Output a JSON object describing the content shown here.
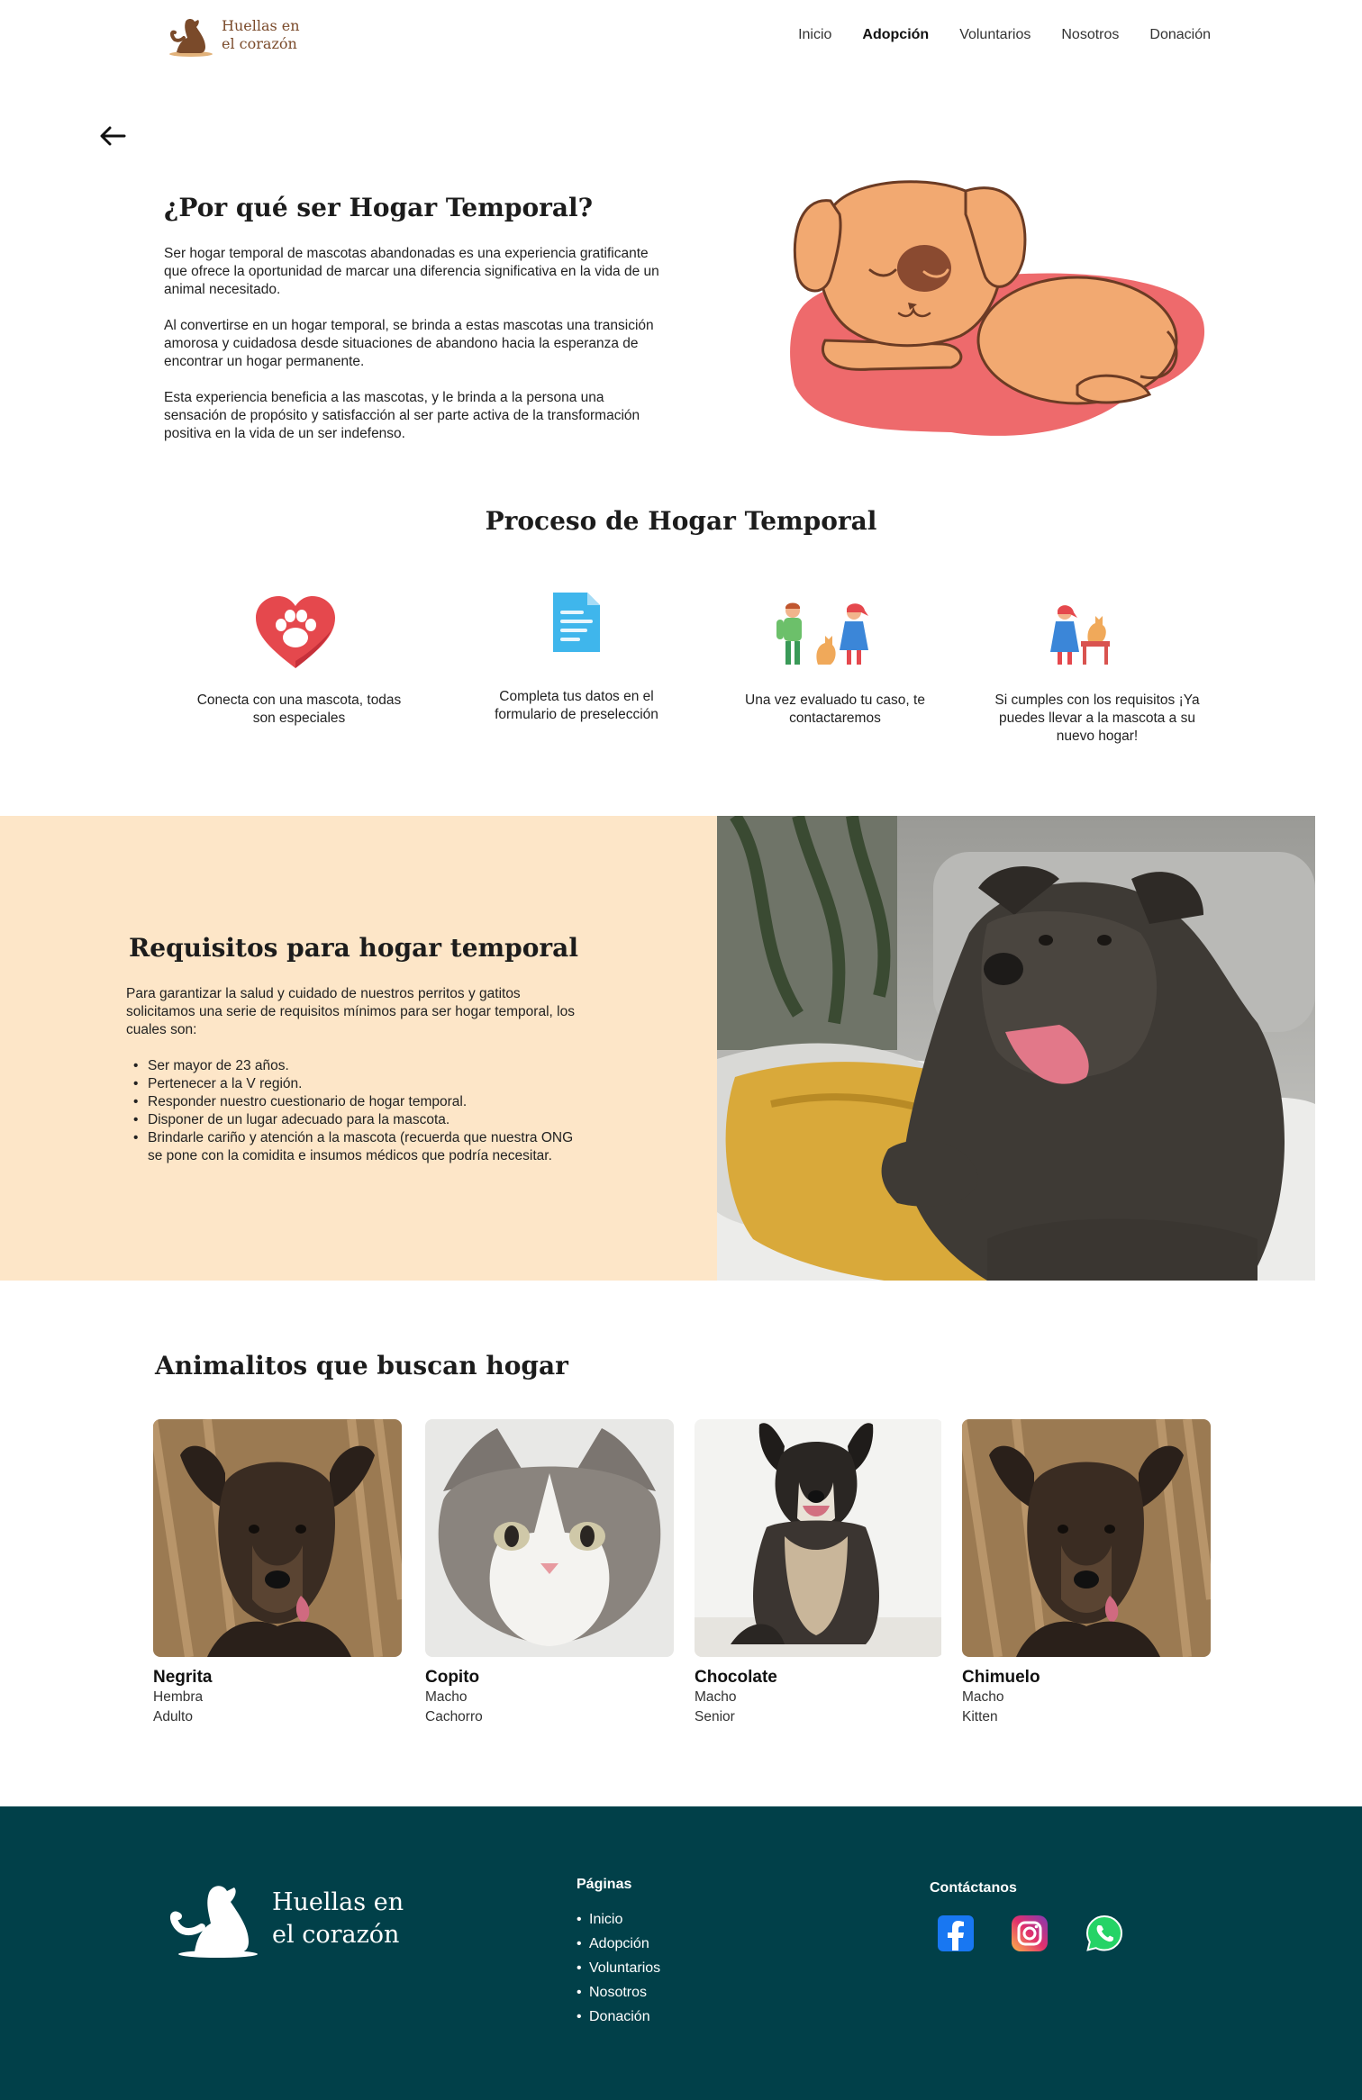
{
  "nav": {
    "brand": "Huellas en el corazón",
    "links": [
      "Inicio",
      "Adopción",
      "Voluntarios",
      "Nosotros",
      "Donación"
    ],
    "active": "Adopción"
  },
  "why": {
    "title": "¿Por qué ser Hogar Temporal?",
    "paragraphs": [
      "Ser hogar temporal de mascotas abandonadas es una experiencia gratificante que ofrece la oportunidad de marcar una diferencia significativa en la vida de un animal necesitado.",
      "Al convertirse en un hogar temporal, se brinda a estas mascotas una transición amorosa y cuidadosa desde situaciones de abandono hacia la esperanza de encontrar un hogar permanente.",
      "Esta experiencia beneficia a las mascotas, y le brinda a la persona una sensación de propósito y satisfacción al ser parte activa de la transformación positiva en la vida de un ser indefenso."
    ]
  },
  "process": {
    "title": "Proceso de Hogar Temporal",
    "steps": [
      {
        "icon": "heart-paw-icon",
        "text": "Conecta con una mascota, todas son especiales"
      },
      {
        "icon": "document-icon",
        "text": "Completa tus datos en el formulario de preselección"
      },
      {
        "icon": "people-pet-icon",
        "text": "Una vez evaluado tu caso, te contactaremos"
      },
      {
        "icon": "person-pet-table-icon",
        "text": "Si cumples con los requisitos ¡Ya puedes llevar a la mascota a su nuevo hogar!"
      }
    ]
  },
  "requirements": {
    "title": "Requisitos para hogar temporal",
    "intro": "Para garantizar la salud y cuidado de nuestros perritos y gatitos solicitamos una serie de requisitos mínimos para ser hogar temporal,  los cuales son:",
    "items": [
      "Ser mayor de 23 años.",
      "Pertenecer a la V región.",
      "Responder nuestro cuestionario de hogar temporal.",
      "Disponer de un lugar adecuado para la mascota.",
      "Brindarle cariño y atención a la mascota (recuerda que nuestra ONG se pone con la comidita e insumos médicos que podría necesitar."
    ]
  },
  "animals": {
    "title": "Animalitos que buscan hogar",
    "cards": [
      {
        "name": "Negrita",
        "sex": "Hembra",
        "age": "Adulto"
      },
      {
        "name": "Copito",
        "sex": "Macho",
        "age": "Cachorro"
      },
      {
        "name": "Chocolate",
        "sex": "Macho",
        "age": "Senior"
      },
      {
        "name": "Chimuelo",
        "sex": "Macho",
        "age": "Kitten"
      }
    ]
  },
  "footer": {
    "brand": "Huellas en el corazón",
    "pages_title": "Páginas",
    "pages": [
      "Inicio",
      "Adopción",
      "Voluntarios",
      "Nosotros",
      "Donación"
    ],
    "contact_title": "Contáctanos",
    "socials": [
      "facebook-icon",
      "instagram-icon",
      "whatsapp-icon"
    ]
  },
  "colors": {
    "band": "#fde6c8",
    "footer": "#014049",
    "accent": "#e85a5f"
  }
}
